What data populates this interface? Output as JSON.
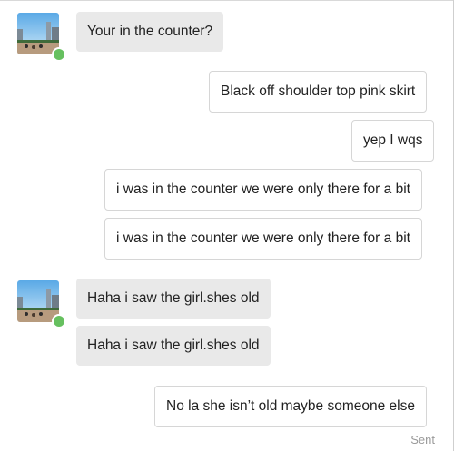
{
  "conversation": {
    "messages": [
      {
        "direction": "received",
        "text": "Your in the counter?"
      },
      {
        "direction": "sent",
        "text": "Black off shoulder top pink skirt"
      },
      {
        "direction": "sent",
        "text": "yep I wqs"
      },
      {
        "direction": "sent",
        "text": "i was in the counter we were only there for a bit"
      },
      {
        "direction": "sent",
        "text": "i was in the counter we were only there for a bit"
      },
      {
        "direction": "received",
        "text": "Haha i saw the girl.shes old"
      },
      {
        "direction": "received",
        "text": "Haha i saw the girl.shes old"
      },
      {
        "direction": "sent",
        "text": "No la she isn’t old maybe someone else"
      }
    ],
    "status": "Sent"
  },
  "contact": {
    "avatar_icon": "contact-avatar-photo",
    "online_indicator": "online-status-dot",
    "online_color": "#66c05f"
  },
  "colors": {
    "received_bubble": "#e9e9e9",
    "sent_bubble_border": "#d6d6d6",
    "text": "#222222",
    "status_text": "#9a9a9a"
  }
}
